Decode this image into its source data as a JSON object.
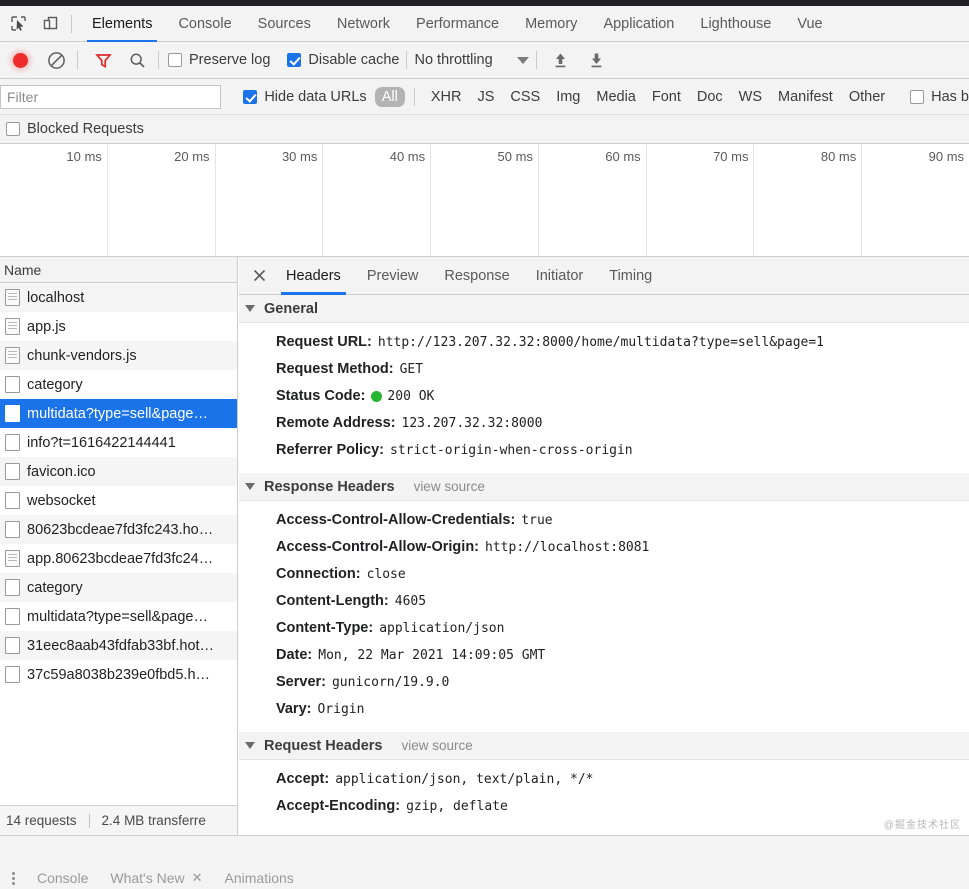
{
  "devtools": {
    "main_tabs": [
      {
        "label": "Elements",
        "active": false
      },
      {
        "label": "Console",
        "active": false
      },
      {
        "label": "Sources",
        "active": false
      },
      {
        "label": "Network",
        "active": true
      },
      {
        "label": "Performance",
        "active": false
      },
      {
        "label": "Memory",
        "active": false
      },
      {
        "label": "Application",
        "active": false
      },
      {
        "label": "Lighthouse",
        "active": false
      },
      {
        "label": "Vue",
        "active": false
      }
    ],
    "inspect_icon": "inspect-element-icon",
    "device_icon": "device-toolbar-icon"
  },
  "network_toolbar": {
    "record_icon": "record-icon",
    "clear_icon": "clear-icon",
    "filter_icon": "filter-funnel-icon",
    "search_icon": "search-icon",
    "preserve_log": {
      "label": "Preserve log",
      "checked": false
    },
    "disable_cache": {
      "label": "Disable cache",
      "checked": true
    },
    "throttling": {
      "value": "No throttling",
      "caret": "chevron-down-icon"
    },
    "import_icon": "import-har-icon",
    "export_icon": "export-har-icon"
  },
  "filter_bar": {
    "filter_placeholder": "Filter",
    "filter_value": "",
    "hide_data_urls": {
      "label": "Hide data URLs",
      "checked": true
    },
    "types": [
      {
        "label": "All",
        "selected": true
      },
      {
        "label": "XHR",
        "selected": false
      },
      {
        "label": "JS",
        "selected": false
      },
      {
        "label": "CSS",
        "selected": false
      },
      {
        "label": "Img",
        "selected": false
      },
      {
        "label": "Media",
        "selected": false
      },
      {
        "label": "Font",
        "selected": false
      },
      {
        "label": "Doc",
        "selected": false
      },
      {
        "label": "WS",
        "selected": false
      },
      {
        "label": "Manifest",
        "selected": false
      },
      {
        "label": "Other",
        "selected": false
      }
    ],
    "has_blocked": {
      "label": "Has b",
      "checked": false
    },
    "blocked_requests": {
      "label": "Blocked Requests",
      "checked": false
    }
  },
  "overview": {
    "ticks": [
      "10 ms",
      "20 ms",
      "30 ms",
      "40 ms",
      "50 ms",
      "60 ms",
      "70 ms",
      "80 ms",
      "90 ms"
    ]
  },
  "request_list": {
    "column_header": "Name",
    "rows": [
      {
        "name": "localhost",
        "icon": "document-icon",
        "selected": false
      },
      {
        "name": "app.js",
        "icon": "document-icon",
        "selected": false
      },
      {
        "name": "chunk-vendors.js",
        "icon": "document-icon",
        "selected": false
      },
      {
        "name": "category",
        "icon": "generic-file-icon",
        "selected": false
      },
      {
        "name": "multidata?type=sell&page…",
        "icon": "generic-file-icon",
        "selected": true
      },
      {
        "name": "info?t=1616422144441",
        "icon": "generic-file-icon",
        "selected": false
      },
      {
        "name": "favicon.ico",
        "icon": "generic-file-icon",
        "selected": false
      },
      {
        "name": "websocket",
        "icon": "generic-file-icon",
        "selected": false
      },
      {
        "name": "80623bcdeae7fd3fc243.ho…",
        "icon": "generic-file-icon",
        "selected": false
      },
      {
        "name": "app.80623bcdeae7fd3fc24…",
        "icon": "document-icon",
        "selected": false
      },
      {
        "name": "category",
        "icon": "generic-file-icon",
        "selected": false
      },
      {
        "name": "multidata?type=sell&page…",
        "icon": "generic-file-icon",
        "selected": false
      },
      {
        "name": "31eec8aab43fdfab33bf.hot…",
        "icon": "generic-file-icon",
        "selected": false
      },
      {
        "name": "37c59a8038b239e0fbd5.h…",
        "icon": "generic-file-icon",
        "selected": false
      }
    ],
    "status": {
      "requests": "14 requests",
      "transferred": "2.4 MB transferre"
    }
  },
  "detail": {
    "close_icon": "close-icon",
    "tabs": [
      {
        "label": "Headers",
        "active": true
      },
      {
        "label": "Preview",
        "active": false
      },
      {
        "label": "Response",
        "active": false
      },
      {
        "label": "Initiator",
        "active": false
      },
      {
        "label": "Timing",
        "active": false
      }
    ],
    "general": {
      "title": "General",
      "rows": [
        {
          "name": "Request URL:",
          "value": "http://123.207.32.32:8000/home/multidata?type=sell&page=1"
        },
        {
          "name": "Request Method:",
          "value": "GET"
        },
        {
          "name": "Status Code:",
          "value": "200 OK",
          "status_dot": "#25b52e"
        },
        {
          "name": "Remote Address:",
          "value": "123.207.32.32:8000"
        },
        {
          "name": "Referrer Policy:",
          "value": "strict-origin-when-cross-origin"
        }
      ]
    },
    "response_headers": {
      "title": "Response Headers",
      "view_source": "view source",
      "rows": [
        {
          "name": "Access-Control-Allow-Credentials:",
          "value": "true"
        },
        {
          "name": "Access-Control-Allow-Origin:",
          "value": "http://localhost:8081"
        },
        {
          "name": "Connection:",
          "value": "close"
        },
        {
          "name": "Content-Length:",
          "value": "4605"
        },
        {
          "name": "Content-Type:",
          "value": "application/json"
        },
        {
          "name": "Date:",
          "value": "Mon, 22 Mar 2021 14:09:05 GMT"
        },
        {
          "name": "Server:",
          "value": "gunicorn/19.9.0"
        },
        {
          "name": "Vary:",
          "value": "Origin"
        }
      ]
    },
    "request_headers": {
      "title": "Request Headers",
      "view_source": "view source",
      "rows": [
        {
          "name": "Accept:",
          "value": "application/json, text/plain, */*"
        },
        {
          "name": "Accept-Encoding:",
          "value": "gzip, deflate"
        }
      ]
    },
    "watermark": "@掘金技术社区"
  },
  "drawer": {
    "menu_icon": "more-options-icon",
    "tabs": [
      {
        "label": "Console",
        "closable": false
      },
      {
        "label": "What's New",
        "closable": true
      },
      {
        "label": "Animations",
        "closable": false
      }
    ]
  },
  "colors": {
    "accent": "#1a73e8",
    "record": "#ee2c2c",
    "status_ok": "#25b52e",
    "toolbar_bg": "#f3f3f3"
  }
}
